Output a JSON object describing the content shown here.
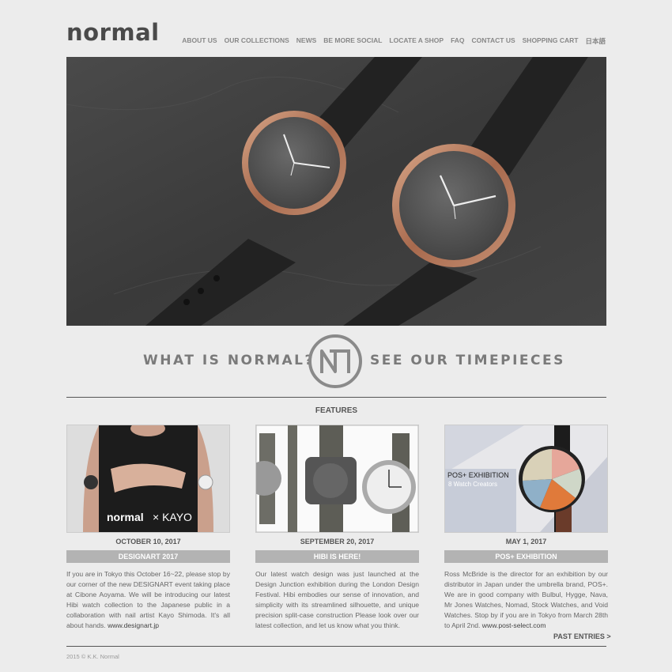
{
  "brand": {
    "logo": "normal"
  },
  "nav": {
    "items": [
      "ABOUT US",
      "OUR COLLECTIONS",
      "NEWS",
      "BE MORE SOCIAL",
      "LOCATE A SHOP",
      "FAQ",
      "CONTACT US",
      "SHOPPING CART",
      "日本語"
    ]
  },
  "tagline": {
    "left": "WHAT IS NORMAL?",
    "right": "SEE OUR TIMEPIECES"
  },
  "features": {
    "title": "FEATURES",
    "cards": [
      {
        "date": "OCTOBER 10, 2017",
        "title": "DESIGNART 2017",
        "image_caption_1": "normal",
        "image_caption_2": "× KAYO",
        "body": "If you are in Tokyo this October 16~22, please stop by our corner of the new DESIGNART event taking place at Cibone Aoyama. We will be introducing our latest Hibi watch collection to the Japanese public in a collaboration with nail artist Kayo Shimoda. It's all about hands.",
        "link": "www.designart.jp"
      },
      {
        "date": "SEPTEMBER 20, 2017",
        "title": "HIBI IS HERE!",
        "body": "Our latest watch design was just launched at the Design Junction exhibition during the London Design Festival. Hibi embodies our sense of innovation, and simplicity with its streamlined silhouette, and unique precision split-case construction Please look over our latest collection, and let us know what you think.",
        "link": ""
      },
      {
        "date": "MAY 1, 2017",
        "title": "POS+ EXHIBITION",
        "image_caption_1": "POS+ EXHIBITION",
        "image_caption_2": "8 Watch Creators",
        "body": "Ross McBride is the director for an exhibition by our distributor in Japan under the umbrella brand, POS+. We are in good company with Bulbul, Hygge, Nava, Mr Jones Watches, Nomad, Stock Watches, and Void Watches. Stop by if you are in Tokyo from March 28th to April 2nd.",
        "link": "www.post-select.com"
      }
    ],
    "past_entries": "PAST ENTRIES >"
  },
  "footer": {
    "copyright": "2015 © K.K. Normal"
  },
  "colors": {
    "background": "#ececec",
    "bar": "#b3b3b3",
    "text": "#555555"
  }
}
